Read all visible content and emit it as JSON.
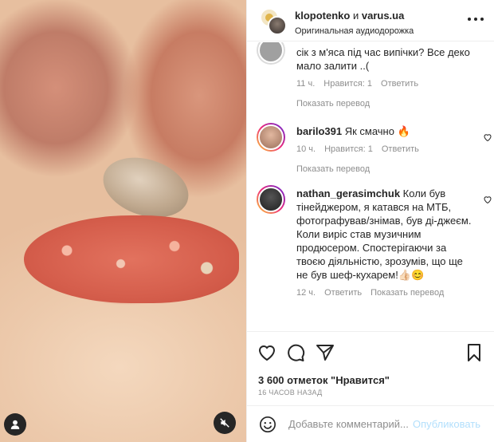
{
  "header": {
    "author1": "klopotenko",
    "separator": "и",
    "author2": "varus.ua",
    "audio": "Оригинальная аудиодорожка",
    "more_icon": "more-horizontal-icon"
  },
  "comments": [
    {
      "text": "сік з м'яса під час випічки? Все деко мало залити ..(",
      "time": "11 ч.",
      "likes": "Нравится: 1",
      "reply": "Ответить",
      "translate": "Показать перевод"
    },
    {
      "username": "barilo391",
      "text": "Як смачно 🔥",
      "time": "10 ч.",
      "likes": "Нравится: 1",
      "reply": "Ответить",
      "translate": "Показать перевод"
    },
    {
      "username": "nathan_gerasimchuk",
      "text": "Коли був тінейджером, я катався на МТБ, фотографував/знімав, був ді-джеєм. Коли виріс став музичним продюсером. Спостерігаючи за твоєю діяльністю, зрозумів, що ще не був шеф-кухарем!👍🏻😊",
      "time": "12 ч.",
      "reply": "Ответить",
      "translate": "Показать перевод"
    }
  ],
  "actions": {
    "likes_count": "3 600 отметок \"Нравится\"",
    "timestamp": "16 ЧАСОВ НАЗАД"
  },
  "add_comment": {
    "placeholder": "Добавьте комментарий...",
    "publish": "Опубликовать"
  },
  "colors": {
    "text": "#262626",
    "secondary": "#8e8e8e",
    "publish_disabled": "#b2dffc",
    "border": "#efefef"
  }
}
